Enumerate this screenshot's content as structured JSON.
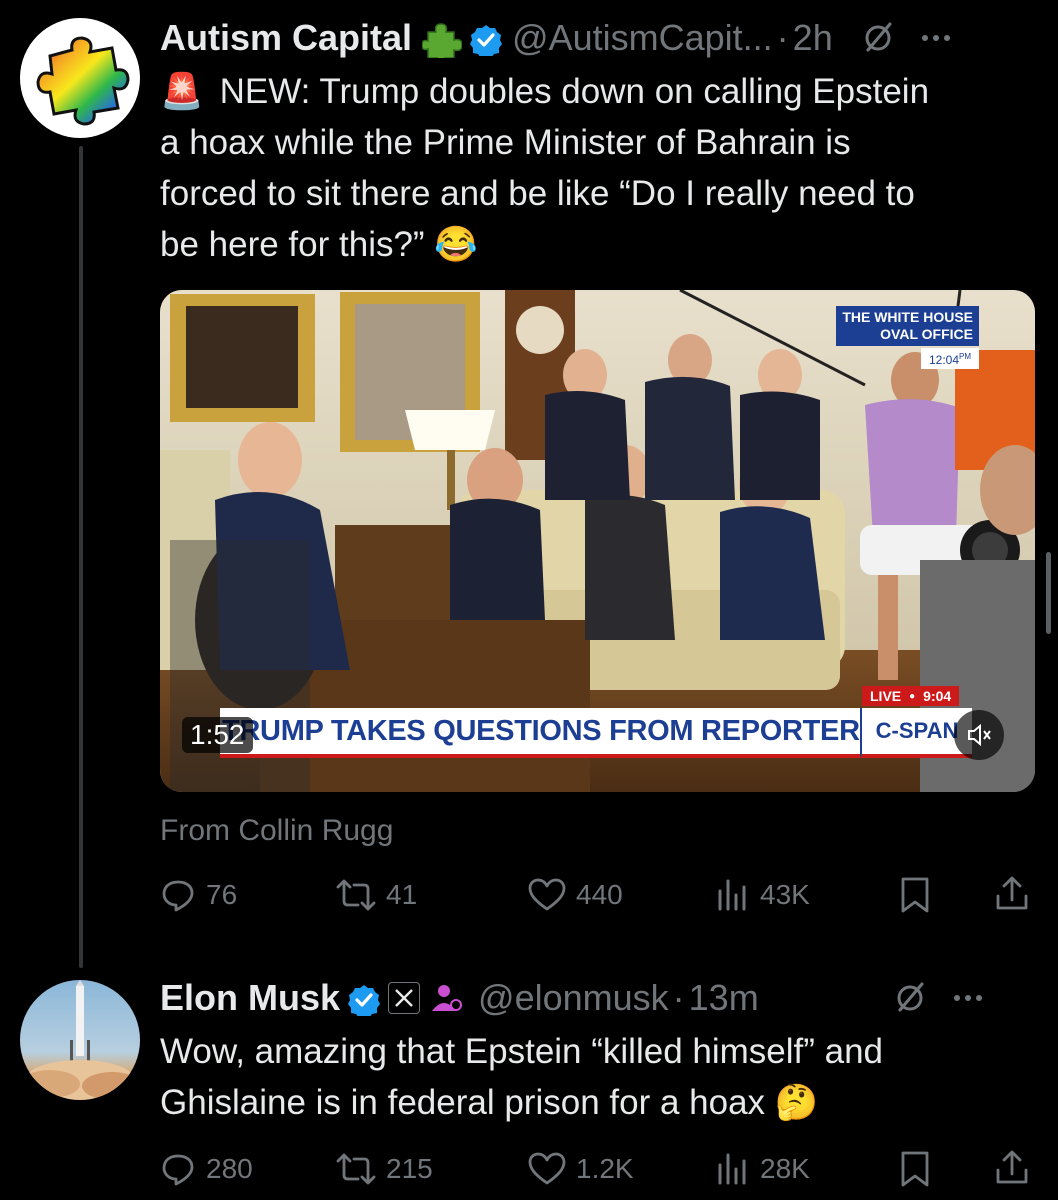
{
  "post1": {
    "author_name": "Autism Capital",
    "handle": "@AutismCapit...",
    "dot": "·",
    "time": "2h",
    "text_lines": [
      "NEW: Trump doubles down on calling Epstein",
      "a hoax while the Prime Minister of Bahrain is",
      "forced to sit there and be like “Do I really need to",
      "be here for this?”"
    ],
    "emoji_siren": "🚨",
    "emoji_laugh": "😂",
    "video": {
      "duration": "1:52",
      "chyron": "TRUMP TAKES QUESTIONS FROM REPORTERS",
      "network": "C-SPAN",
      "location_line1": "THE WHITE HOUSE",
      "location_line2": "OVAL OFFICE",
      "time_small": "12:04",
      "time_small_suffix": "PM",
      "live_label": "LIVE",
      "live_time": "9:04"
    },
    "attribution": "From Collin Rugg",
    "replies": "76",
    "reposts": "41",
    "likes": "440",
    "views": "43K"
  },
  "post2": {
    "author_name": "Elon Musk",
    "handle": "@elonmusk",
    "dot": "·",
    "time": "13m",
    "text_lines": [
      "Wow, amazing that Epstein “killed himself” and",
      "Ghislaine is in federal prison for a hoax"
    ],
    "emoji_think": "🤔",
    "replies": "280",
    "reposts": "215",
    "likes": "1.2K",
    "views": "28K"
  },
  "colors": {
    "background": "#000000",
    "text": "#e7e9ea",
    "muted": "#71767b",
    "verified_blue": "#1d9bf0",
    "cspan_blue": "#1c3f94"
  }
}
